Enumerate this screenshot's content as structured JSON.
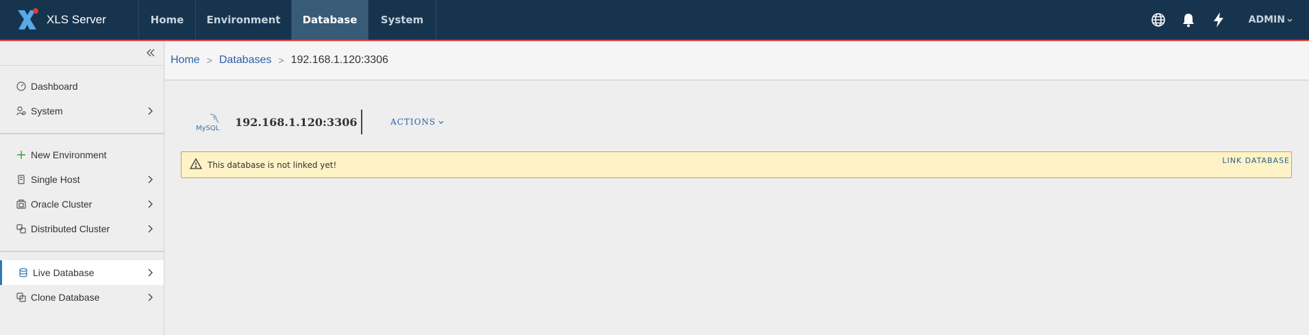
{
  "app": {
    "title": "XLS Server"
  },
  "nav": {
    "tabs": [
      {
        "label": "Home",
        "active": false
      },
      {
        "label": "Environment",
        "active": false
      },
      {
        "label": "Database",
        "active": true
      },
      {
        "label": "System",
        "active": false
      }
    ],
    "user": "ADMIN",
    "icons": [
      "globe-icon",
      "bell-icon",
      "lightning-icon"
    ]
  },
  "sidebar": {
    "groups": [
      [
        {
          "label": "Dashboard",
          "icon": "dashboard-icon",
          "chevron": false
        },
        {
          "label": "System",
          "icon": "system-icon",
          "chevron": true
        }
      ],
      [
        {
          "label": "New Environment",
          "icon": "plus-icon",
          "chevron": false
        },
        {
          "label": "Single Host",
          "icon": "host-icon",
          "chevron": true
        },
        {
          "label": "Oracle Cluster",
          "icon": "cluster-icon",
          "chevron": true
        },
        {
          "label": "Distributed Cluster",
          "icon": "distributed-icon",
          "chevron": true
        }
      ],
      [
        {
          "label": "Live Database",
          "icon": "database-icon",
          "chevron": true,
          "active": true
        },
        {
          "label": "Clone Database",
          "icon": "clone-icon",
          "chevron": true
        }
      ]
    ]
  },
  "breadcrumb": {
    "home": "Home",
    "databases": "Databases",
    "separator": ">",
    "current": "192.168.1.120:3306"
  },
  "database": {
    "title": "192.168.1.120:3306",
    "logo_text": "MySQL",
    "actions_label": "ACTIONS"
  },
  "alert": {
    "message": "This database is not linked yet!",
    "link_label": "LINK DATABASE"
  },
  "colors": {
    "topbar": "#17344f",
    "accent_red": "#e04545",
    "link": "#2a5fa5",
    "alert_bg": "#fdf3c6"
  }
}
